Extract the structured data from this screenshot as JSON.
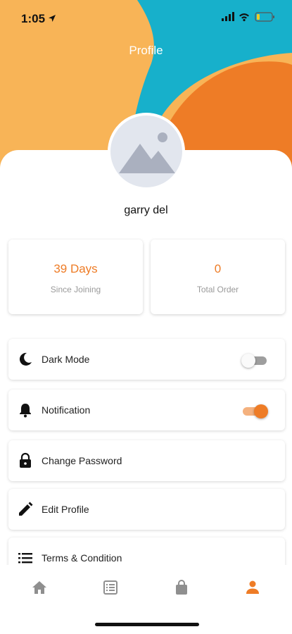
{
  "status_bar": {
    "time": "1:05"
  },
  "header": {
    "title": "Profile"
  },
  "profile": {
    "name": "garry del"
  },
  "stats": [
    {
      "value": "39 Days",
      "label": "Since Joining"
    },
    {
      "value": "0",
      "label": "Total Order"
    }
  ],
  "settings": {
    "dark_mode": {
      "label": "Dark Mode",
      "enabled": false
    },
    "notification": {
      "label": "Notification",
      "enabled": true
    },
    "change_password": {
      "label": "Change Password"
    },
    "edit_profile": {
      "label": "Edit Profile"
    },
    "terms": {
      "label": "Terms & Condition"
    }
  },
  "bottom_nav": [
    {
      "icon": "home-icon",
      "active": false
    },
    {
      "icon": "list-icon",
      "active": false
    },
    {
      "icon": "shopping-bag-icon",
      "active": false
    },
    {
      "icon": "person-icon",
      "active": true
    }
  ],
  "colors": {
    "accent": "#ee7c26",
    "header_yellow": "#f8b457",
    "header_teal": "#17b0cb",
    "header_orange": "#ee7c26",
    "inactive_icon": "#8f8f8f"
  }
}
